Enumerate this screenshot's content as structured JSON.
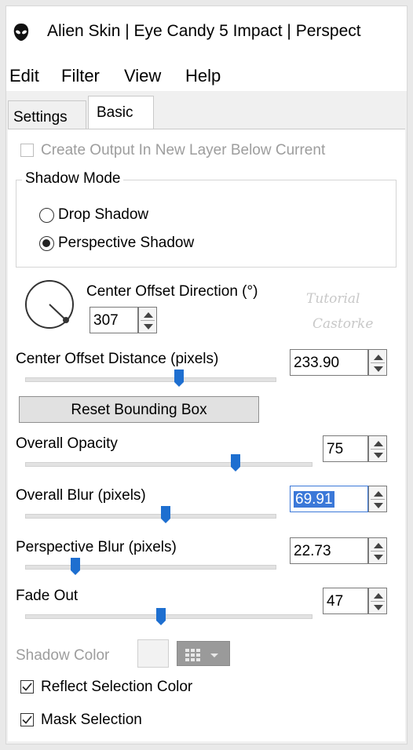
{
  "window": {
    "title": "Alien Skin | Eye Candy 5 Impact | Perspect",
    "app_icon": "alien-head-icon"
  },
  "menu": [
    "Edit",
    "Filter",
    "View",
    "Help"
  ],
  "tabs": [
    {
      "label": "Settings",
      "active": false
    },
    {
      "label": "Basic",
      "active": true
    }
  ],
  "basic": {
    "create_output_label": "Create Output In New Layer Below Current",
    "create_output_checked": false,
    "shadow_mode": {
      "legend": "Shadow Mode",
      "options": [
        {
          "label": "Drop Shadow",
          "selected": false
        },
        {
          "label": "Perspective Shadow",
          "selected": true
        }
      ]
    },
    "center_offset_direction": {
      "label": "Center Offset Direction (°)",
      "value": "307"
    },
    "center_offset_distance": {
      "label": "Center Offset Distance (pixels)",
      "value": "233.90",
      "slider_fraction": 0.61
    },
    "reset_button": "Reset Bounding Box",
    "overall_opacity": {
      "label": "Overall Opacity",
      "value": "75",
      "slider_fraction": 0.74
    },
    "overall_blur": {
      "label": "Overall Blur (pixels)",
      "value": "69.91",
      "slider_fraction": 0.55,
      "selected": true
    },
    "perspective_blur": {
      "label": "Perspective Blur (pixels)",
      "value": "22.73",
      "slider_fraction": 0.19
    },
    "fade_out": {
      "label": "Fade Out",
      "value": "47",
      "slider_fraction": 0.47
    },
    "shadow_color_label": "Shadow Color",
    "reflect_selection": {
      "label": "Reflect Selection Color",
      "checked": true
    },
    "mask_selection": {
      "label": "Mask Selection",
      "checked": true
    }
  },
  "watermark": {
    "line1": "Tutorial",
    "line2": "Castorke"
  },
  "colors": {
    "slider_thumb": "#1e6fd0",
    "selection": "#3b78d8",
    "disabled_text": "#9d9d9d"
  }
}
